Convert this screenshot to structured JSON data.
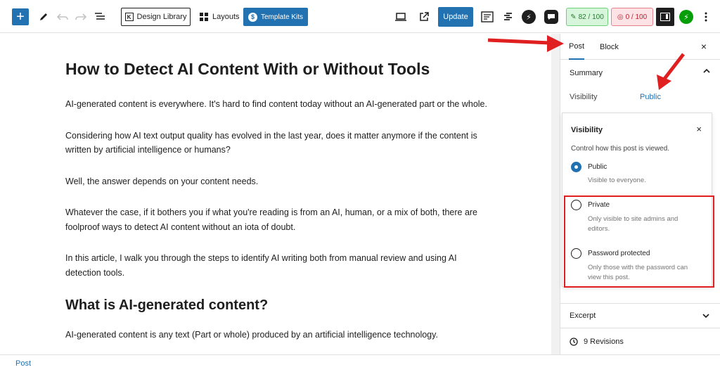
{
  "toolbar": {
    "add_block": "+",
    "design_library": "Design Library",
    "design_library_logo": "K",
    "layouts": "Layouts",
    "template_kits": "Template Kits",
    "update": "Update",
    "seo_score": "82 / 100",
    "readability_score": "0 / 100",
    "jetpack": "⚡"
  },
  "article": {
    "title": "How to Detect AI Content With or Without Tools",
    "paragraphs": [
      "AI-generated content is everywhere. It's hard to find content today without an AI-generated part or the whole.",
      "Considering how AI text output quality has evolved in the last year, does it matter anymore if the content is written by artificial intelligence or humans?",
      "Well, the answer depends on your content needs.",
      "Whatever the case, if it bothers you if what you're reading is from an AI, human, or a mix of both, there are foolproof ways to detect AI content without an iota of doubt.",
      "In this article, I walk you through the steps to identify AI writing both from manual review and using AI detection tools."
    ],
    "heading2": "What is AI-generated content?",
    "paragraph_after": "AI-generated content is any text (Part or whole) produced by an artificial intelligence technology."
  },
  "sidebar": {
    "tab_post": "Post",
    "tab_block": "Block",
    "close": "×",
    "summary": "Summary",
    "visibility_label": "Visibility",
    "visibility_value": "Public",
    "excerpt": "Excerpt",
    "revisions": "9 Revisions"
  },
  "popover": {
    "title": "Visibility",
    "close": "×",
    "description": "Control how this post is viewed.",
    "options": [
      {
        "label": "Public",
        "help": "Visible to everyone.",
        "checked": true
      },
      {
        "label": "Private",
        "help": "Only visible to site admins and editors.",
        "checked": false
      },
      {
        "label": "Password protected",
        "help": "Only those with the password can view this post.",
        "checked": false
      }
    ]
  },
  "footer": {
    "breadcrumb": "Post"
  },
  "colors": {
    "accent": "#2271b1",
    "annotation_red": "#e02020"
  }
}
